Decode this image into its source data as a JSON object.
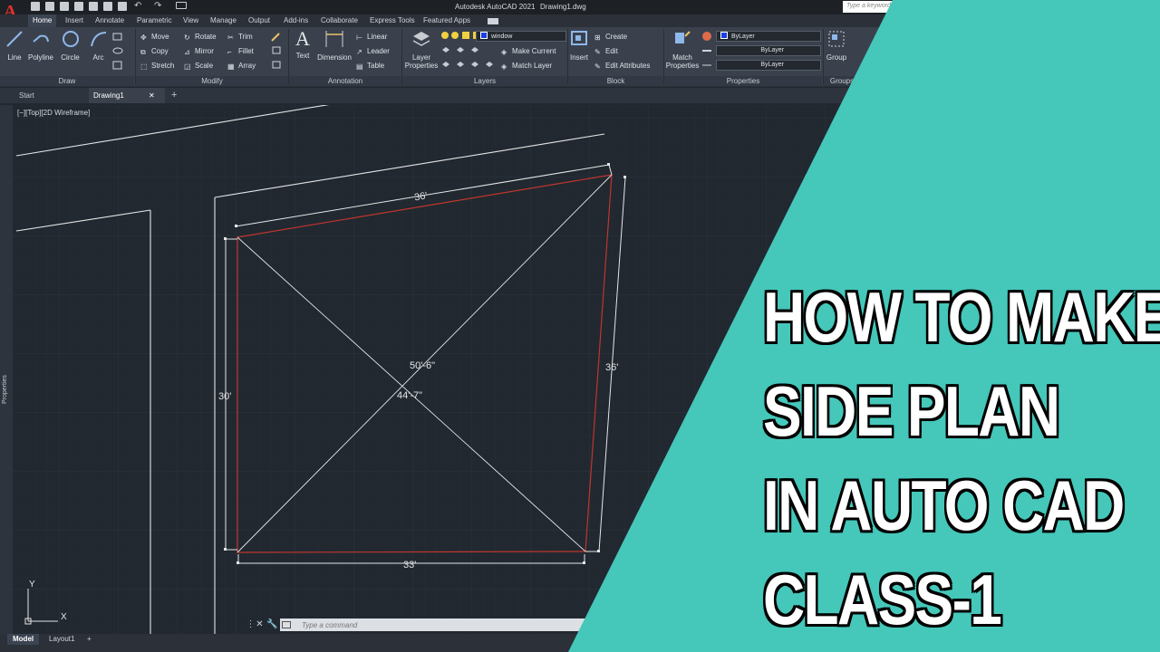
{
  "titlebar": {
    "app_title": "Autodesk AutoCAD 2021",
    "doc_title": "Drawing1.dwg",
    "search_placeholder": "Type a keyword"
  },
  "ribbon_tabs": [
    "Home",
    "Insert",
    "Annotate",
    "Parametric",
    "View",
    "Manage",
    "Output",
    "Add-ins",
    "Collaborate",
    "Express Tools",
    "Featured Apps"
  ],
  "draw": {
    "line": "Line",
    "polyline": "Polyline",
    "circle": "Circle",
    "arc": "Arc",
    "footer": "Draw"
  },
  "modify": {
    "move": "Move",
    "rotate": "Rotate",
    "trim": "Trim",
    "copy": "Copy",
    "mirror": "Mirror",
    "fillet": "Fillet",
    "stretch": "Stretch",
    "scale": "Scale",
    "array": "Array",
    "footer": "Modify"
  },
  "annotation": {
    "text": "Text",
    "dimension": "Dimension",
    "linear": "Linear",
    "leader": "Leader",
    "table": "Table",
    "footer": "Annotation"
  },
  "layers": {
    "layer_properties_1": "Layer",
    "layer_properties_2": "Properties",
    "current_layer": "window",
    "make_current": "Make Current",
    "match_layer": "Match Layer",
    "footer": "Layers"
  },
  "block": {
    "insert": "Insert",
    "create": "Create",
    "edit": "Edit",
    "edit_attributes": "Edit Attributes",
    "footer": "Block"
  },
  "properties": {
    "match_1": "Match",
    "match_2": "Properties",
    "color": "ByLayer",
    "linetype": "ByLayer",
    "lineweight": "ByLayer",
    "footer": "Properties"
  },
  "groups": {
    "group": "Group",
    "footer": "Groups"
  },
  "filetabs": {
    "start": "Start",
    "drawing": "Drawing1"
  },
  "viewport": {
    "label": "[−][Top][2D Wireframe]"
  },
  "sidebar": {
    "properties_label": "Properties"
  },
  "drawing": {
    "dims": {
      "top": "36'",
      "right": "36'",
      "left": "30'",
      "bottom": "33'",
      "diag_1": "50'-6\"",
      "diag_2": "44'-7\""
    },
    "ucs": {
      "x": "X",
      "y": "Y"
    },
    "colors": {
      "background": "#212830",
      "red_line": "#c0362c",
      "white_line": "#e6e6e6"
    }
  },
  "command": {
    "placeholder": "Type a command"
  },
  "layout_tabs": [
    "Model",
    "Layout1",
    "+"
  ],
  "overlay": {
    "lines": [
      "HOW TO MAKE",
      "SIDE PLAN",
      "IN AUTO CAD",
      "CLASS-1"
    ],
    "accent_color": "#45c7ba"
  }
}
